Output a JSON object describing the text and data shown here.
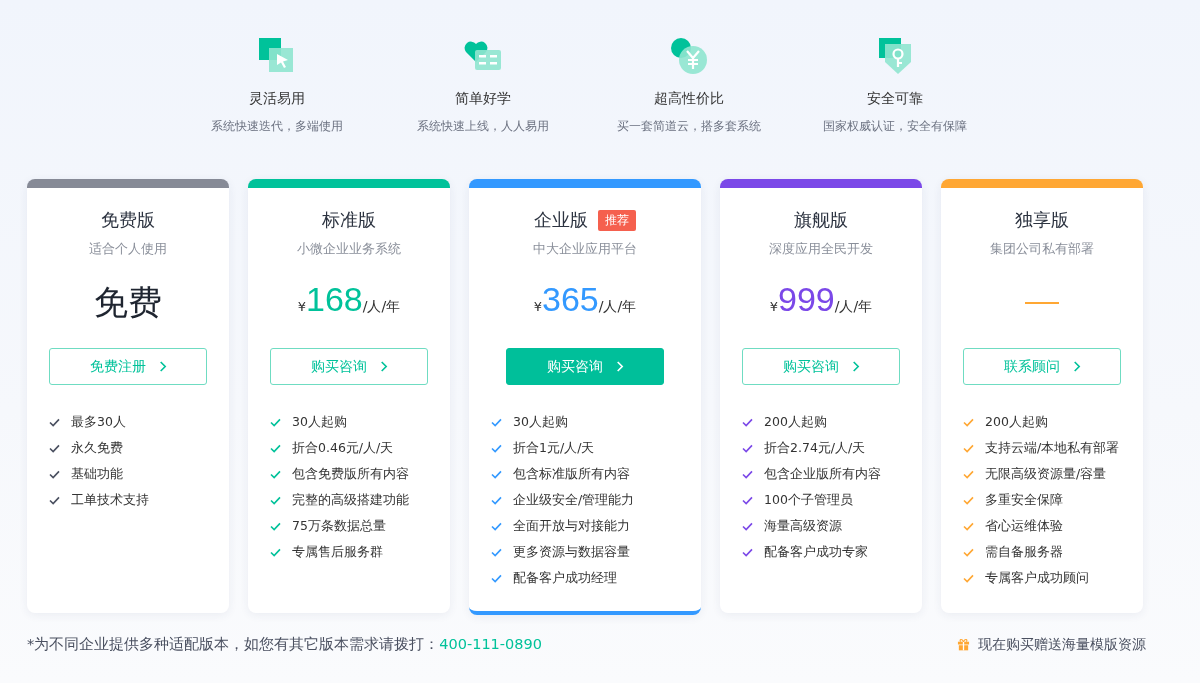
{
  "features": [
    {
      "kind": "cursor",
      "title": "灵活易用",
      "desc": "系统快速迭代，多端使用"
    },
    {
      "kind": "heart",
      "title": "简单好学",
      "desc": "系统快速上线，人人易用"
    },
    {
      "kind": "yen",
      "title": "超高性价比",
      "desc": "买一套简道云，搭多套系统"
    },
    {
      "kind": "shield",
      "title": "安全可靠",
      "desc": "国家权威认证，安全有保障"
    }
  ],
  "plans": [
    {
      "name": "免费版",
      "subtitle": "适合个人使用",
      "color": "#868a96",
      "featured": false,
      "price": {
        "kind": "text",
        "text": "免费"
      },
      "button": "免费注册",
      "items": [
        "最多30人",
        "永久免费",
        "基础功能",
        "工单技术支持"
      ]
    },
    {
      "name": "标准版",
      "subtitle": "小微企业业务系统",
      "color": "#00c29a",
      "featured": false,
      "price": {
        "kind": "amount",
        "currency": "¥",
        "amount": "168",
        "unit": "/人/年"
      },
      "button": "购买咨询",
      "items": [
        "30人起购",
        "折合0.46元/人/天",
        "包含免费版所有内容",
        "完整的高级搭建功能",
        "75万条数据总量",
        "专属售后服务群"
      ]
    },
    {
      "name": "企业版",
      "subtitle": "中大企业应用平台",
      "color": "#3399ff",
      "featured": true,
      "badge": "推荐",
      "price": {
        "kind": "amount",
        "currency": "¥",
        "amount": "365",
        "unit": "/人/年"
      },
      "button": "购买咨询",
      "items": [
        "30人起购",
        "折合1元/人/天",
        "包含标准版所有内容",
        "企业级安全/管理能力",
        "全面开放与对接能力",
        "更多资源与数据容量",
        "配备客户成功经理"
      ]
    },
    {
      "name": "旗舰版",
      "subtitle": "深度应用全民开发",
      "color": "#7b48e8",
      "featured": false,
      "price": {
        "kind": "amount",
        "currency": "¥",
        "amount": "999",
        "unit": "/人/年"
      },
      "button": "购买咨询",
      "items": [
        "200人起购",
        "折合2.74元/人/天",
        "包含企业版所有内容",
        "100个子管理员",
        "海量高级资源",
        "配备客户成功专家"
      ]
    },
    {
      "name": "独享版",
      "subtitle": "集团公司私有部署",
      "color": "#ffa733",
      "featured": false,
      "price": {
        "kind": "dash"
      },
      "button": "联系顾问",
      "items": [
        "200人起购",
        "支持云端/本地私有部署",
        "无限高级资源量/容量",
        "多重安全保障",
        "省心运维体验",
        "需自备服务器",
        "专属客户成功顾问"
      ]
    }
  ],
  "footer": {
    "note": "*为不同企业提供多种适配版本，如您有其它版本需求请拨打：",
    "phone": "400-111-0890",
    "promo": "现在购买赠送海量模版资源"
  }
}
